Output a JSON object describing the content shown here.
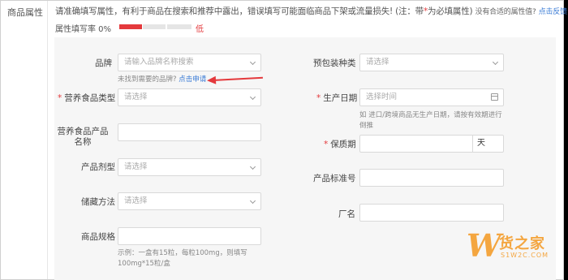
{
  "section": {
    "label": "商品属性"
  },
  "notice": {
    "text_a": "请准确填写属性，有利于商品在搜索和推荐中露出，错误填写可能面临商品下架或流量损失! (注：带",
    "star": "*",
    "text_b": "为必填属性)",
    "small_text": "没有合适的属性值?",
    "link": "点击反馈"
  },
  "fill_rate": {
    "label": "属性填写率 0%",
    "level": "低",
    "segments_filled": 1,
    "segments_total": 3
  },
  "fields": {
    "brand": {
      "label": "品牌",
      "placeholder": "请输入品牌名称搜索",
      "hint": "未找到需要的品牌?",
      "hint_link": "点击申请"
    },
    "package_type": {
      "label": "预包装种类",
      "placeholder": "请选择"
    },
    "nutrition_type": {
      "label": "营养食品类型",
      "required": "*",
      "placeholder": "请选择"
    },
    "production_date": {
      "label": "生产日期",
      "required": "*",
      "placeholder": "选择时间",
      "hint": "如 进口/跨境商品无生产日期，请按有效期进行倒推"
    },
    "product_name": {
      "label": "营养食品产品名称",
      "value": ""
    },
    "shelf_life": {
      "label": "保质期",
      "required": "*",
      "unit": "天",
      "value": ""
    },
    "dosage_form": {
      "label": "产品剂型",
      "placeholder": "请选择"
    },
    "standard_no": {
      "label": "产品标准号",
      "value": ""
    },
    "storage": {
      "label": "储藏方法",
      "placeholder": "请选择"
    },
    "manufacturer": {
      "label": "厂名",
      "value": ""
    },
    "spec": {
      "label": "商品规格",
      "value": "",
      "hint": "示例：一盒有15粒，每粒100mg，则填写100mg*15粒/盒"
    }
  },
  "watermark": {
    "cn": "货之家",
    "url": "S1W2C.COM"
  },
  "colors": {
    "accent_red": "#e4393c",
    "link_blue": "#3a7bd5",
    "watermark": "#f4a640"
  },
  "icons": {
    "select": "chevron-down-icon",
    "date": "calendar-icon",
    "annotation": "red-arrow"
  }
}
